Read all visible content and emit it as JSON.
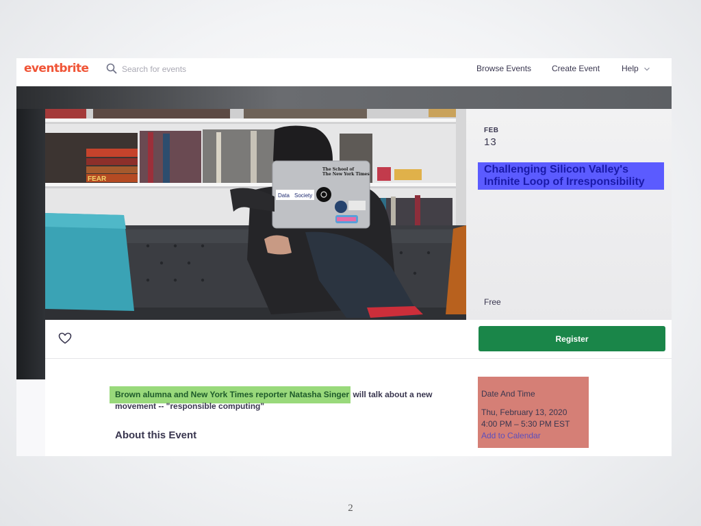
{
  "nav": {
    "logo": "eventbrite",
    "search_placeholder": "Search for events",
    "links": [
      "Browse Events",
      "Create Event",
      "Help"
    ]
  },
  "event": {
    "month": "FEB",
    "day": "13",
    "title": "Challenging Silicon Valley's Infinite Loop of Irresponsibility",
    "price": "Free",
    "register_label": "Register",
    "summary_highlight": "Brown alumna and New York Times reporter Natasha Singer",
    "summary_rest": " will talk about a new movement -- \"responsible computing\"",
    "about_heading": "About this Event",
    "datetime": {
      "heading": "Date And Time",
      "date": "Thu, February 13, 2020",
      "time": "4:00 PM – 5:30 PM EST",
      "add_to_calendar": "Add to Calendar"
    }
  },
  "hero": {
    "laptop_text_1": "The School of",
    "laptop_text_2": "The New York Times",
    "sticker_data": "Data",
    "sticker_society": "Society",
    "book_spine": "FEAR"
  },
  "colors": {
    "brand": "#f05537",
    "register": "#1a8649",
    "title_highlight": "#5b5bff",
    "summary_highlight": "#99d97b",
    "datetime_highlight": "#d57f76"
  },
  "slide": {
    "page_number": "2"
  }
}
